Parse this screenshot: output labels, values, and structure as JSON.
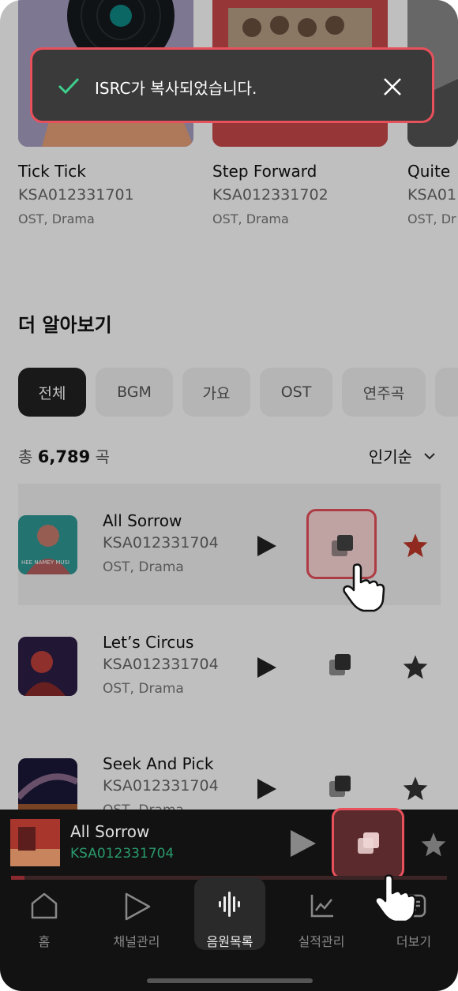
{
  "toast": {
    "message": "ISRC가 복사되었습니다.",
    "icon": "check-icon",
    "close_icon": "close-icon"
  },
  "top_cards": [
    {
      "title": "Tick Tick",
      "isrc": "KSA012331701",
      "genre": "OST, Drama"
    },
    {
      "title": "Step Forward",
      "isrc": "KSA012331702",
      "genre": "OST, Drama"
    },
    {
      "title": "Quite",
      "isrc": "KSA01",
      "genre": "OST, Dr"
    }
  ],
  "section": {
    "title": "더 알아보기",
    "chips": [
      "전체",
      "BGM",
      "가요",
      "OST",
      "연주곡"
    ],
    "total_prefix": "총",
    "total_count": "6,789",
    "total_suffix": "곡",
    "sort_label": "인기순"
  },
  "tracks": [
    {
      "title": "All Sorrow",
      "isrc": "KSA012331704",
      "genre": "OST, Drama",
      "thumb_text": "HEE NAMEY MUSI"
    },
    {
      "title": "Let’s Circus",
      "isrc": "KSA012331704",
      "genre": "OST, Drama"
    },
    {
      "title": "Seek And Pick",
      "isrc": "KSA012331704",
      "genre": "OST, Drama"
    }
  ],
  "player": {
    "title": "All Sorrow",
    "isrc": "KSA012331704",
    "progress": 0.03
  },
  "nav": [
    {
      "label": "홈",
      "icon": "home-icon"
    },
    {
      "label": "채널관리",
      "icon": "play-icon"
    },
    {
      "label": "음원목록",
      "icon": "soundwave-icon"
    },
    {
      "label": "실적관리",
      "icon": "chart-icon"
    },
    {
      "label": "더보기",
      "icon": "more-icon"
    }
  ],
  "colors": {
    "accent_red": "#e8505b",
    "isrc_green": "#2a9a6c",
    "favorite_red": "#c0392b"
  }
}
